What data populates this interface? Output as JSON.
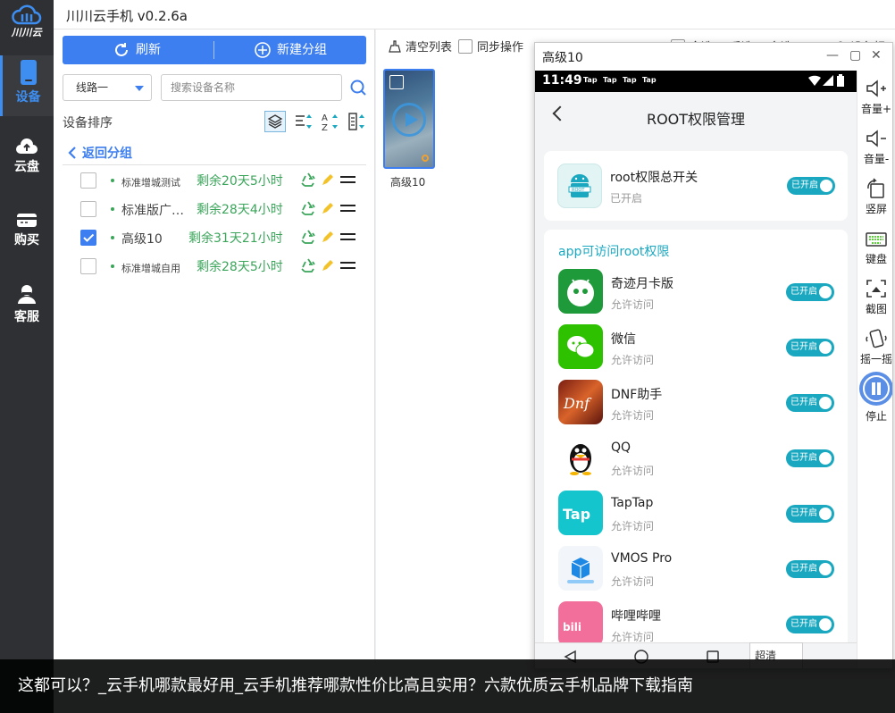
{
  "app": {
    "title": "川川云手机 v0.2.6a",
    "logo_text": "川川云"
  },
  "rail": [
    {
      "label": "设备",
      "icon": "phone-icon",
      "active": true
    },
    {
      "label": "云盘",
      "icon": "cloud-upload-icon",
      "active": false
    },
    {
      "label": "购买",
      "icon": "card-icon",
      "active": false
    },
    {
      "label": "客服",
      "icon": "headset-icon",
      "active": false
    }
  ],
  "panel": {
    "refresh_label": "刷新",
    "new_group_label": "新建分组",
    "route_select": "线路一",
    "search_placeholder": "搜索设备名称",
    "sort_title": "设备排序",
    "back_label": "返回分组",
    "devices": [
      {
        "name": "标准增城测试",
        "remaining": "剩余20天5小时",
        "checked": false,
        "small": true
      },
      {
        "name": "标准版广…",
        "remaining": "剩余28天4小时",
        "checked": false,
        "small": false
      },
      {
        "name": "高级10",
        "remaining": "剩余31天21小时",
        "checked": true,
        "small": false
      },
      {
        "name": "标准增城自用",
        "remaining": "剩余28天5小时",
        "checked": false,
        "small": true
      }
    ]
  },
  "toolbar": {
    "clear_label": "清空列表",
    "sync_label": "同步操作",
    "select_all": "全选",
    "invert": "反选",
    "multi": "多选",
    "device": "设备相"
  },
  "thumbnail": {
    "label": "高级10"
  },
  "phone_window": {
    "title": "高级10",
    "controls": [
      "—",
      "▢",
      "✕"
    ],
    "status": {
      "time": "11:49",
      "tap_labels": [
        "Tap",
        "Tap",
        "Tap",
        "Tap"
      ]
    },
    "page_title": "ROOT权限管理",
    "master": {
      "title": "root权限总开关",
      "sub": "已开启",
      "toggle": "已开启"
    },
    "section_title": "app可访问root权限",
    "apps": [
      {
        "name": "奇迹月卡版",
        "sub": "允许访问",
        "toggle": "已开启",
        "color": "#1f9a3a",
        "icon": "miracle-app-icon"
      },
      {
        "name": "微信",
        "sub": "允许访问",
        "toggle": "已开启",
        "color": "#2dc100",
        "icon": "wechat-icon"
      },
      {
        "name": "DNF助手",
        "sub": "允许访问",
        "toggle": "已开启",
        "color": "#c0452a",
        "icon": "dnf-icon"
      },
      {
        "name": "QQ",
        "sub": "允许访问",
        "toggle": "已开启",
        "color": "#ffffff",
        "icon": "qq-penguin-icon"
      },
      {
        "name": "TapTap",
        "sub": "允许访问",
        "toggle": "已开启",
        "color": "#15c5ce",
        "icon": "taptap-icon"
      },
      {
        "name": "VMOS Pro",
        "sub": "允许访问",
        "toggle": "已开启",
        "color": "#e8f1fb",
        "icon": "vmos-icon"
      },
      {
        "name": "哔哩哔哩",
        "sub": "允许访问",
        "toggle": "已开启",
        "color": "#f36f9b",
        "icon": "bilibili-icon"
      }
    ],
    "quality": "超清",
    "sidebar": [
      {
        "label": "音量+",
        "icon": "volume-up-icon"
      },
      {
        "label": "音量-",
        "icon": "volume-down-icon"
      },
      {
        "label": "竖屏",
        "icon": "rotate-icon"
      },
      {
        "label": "键盘",
        "icon": "keyboard-icon"
      },
      {
        "label": "截图",
        "icon": "screenshot-icon"
      },
      {
        "label": "摇一摇",
        "icon": "shake-icon"
      },
      {
        "label": "停止",
        "icon": "stop-icon"
      }
    ]
  },
  "caption": "这都可以？_云手机哪款最好用_云手机推荐哪款性价比高且实用？六款优质云手机品牌下载指南"
}
